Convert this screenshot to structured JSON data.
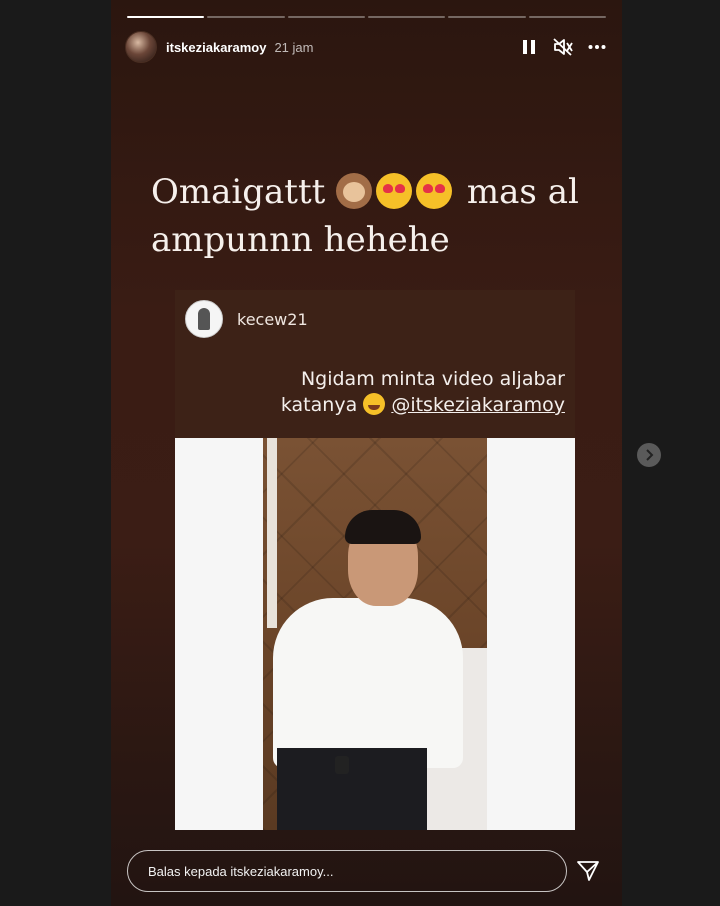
{
  "story": {
    "progress_segments": 6,
    "active_segment": 1,
    "username": "itskeziakaramoy",
    "time": "21 jam",
    "caption_line1": "Omaigattt",
    "caption_line1_end": "mas al",
    "caption_line2": "ampunnn hehehe",
    "emojis": [
      "see-no-evil-monkey",
      "heart-eyes",
      "heart-eyes"
    ]
  },
  "repost": {
    "username": "kecew21",
    "text_line1": "Ngidam minta video aljabar",
    "text_line2": "katanya",
    "mention": "@itskeziakaramoy",
    "emoji": "rolling-laughing"
  },
  "reply": {
    "placeholder": "Balas kepada itskeziakaramoy..."
  },
  "icons": {
    "pause": "pause-icon",
    "mute": "muted-speaker-icon",
    "more": "more-horizontal-icon",
    "send": "send-icon",
    "next": "chevron-right-icon"
  }
}
